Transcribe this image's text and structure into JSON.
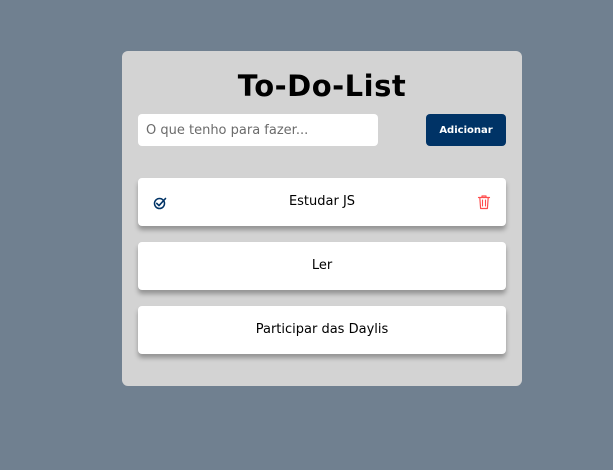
{
  "app": {
    "title": "To-Do-List"
  },
  "form": {
    "input_placeholder": "O que tenho para fazer...",
    "input_value": "",
    "add_label": "Adicionar"
  },
  "tasks": [
    {
      "text": "Estudar JS",
      "actions_visible": true
    },
    {
      "text": "Ler",
      "actions_visible": false
    },
    {
      "text": "Participar das Daylis",
      "actions_visible": false
    }
  ],
  "icons": {
    "check": "check-circle-icon",
    "delete": "trash-icon"
  },
  "colors": {
    "background": "#708090",
    "card": "#d3d3d3",
    "button": "#003366",
    "check_icon": "#003366",
    "delete_icon": "#ff4d4d"
  }
}
